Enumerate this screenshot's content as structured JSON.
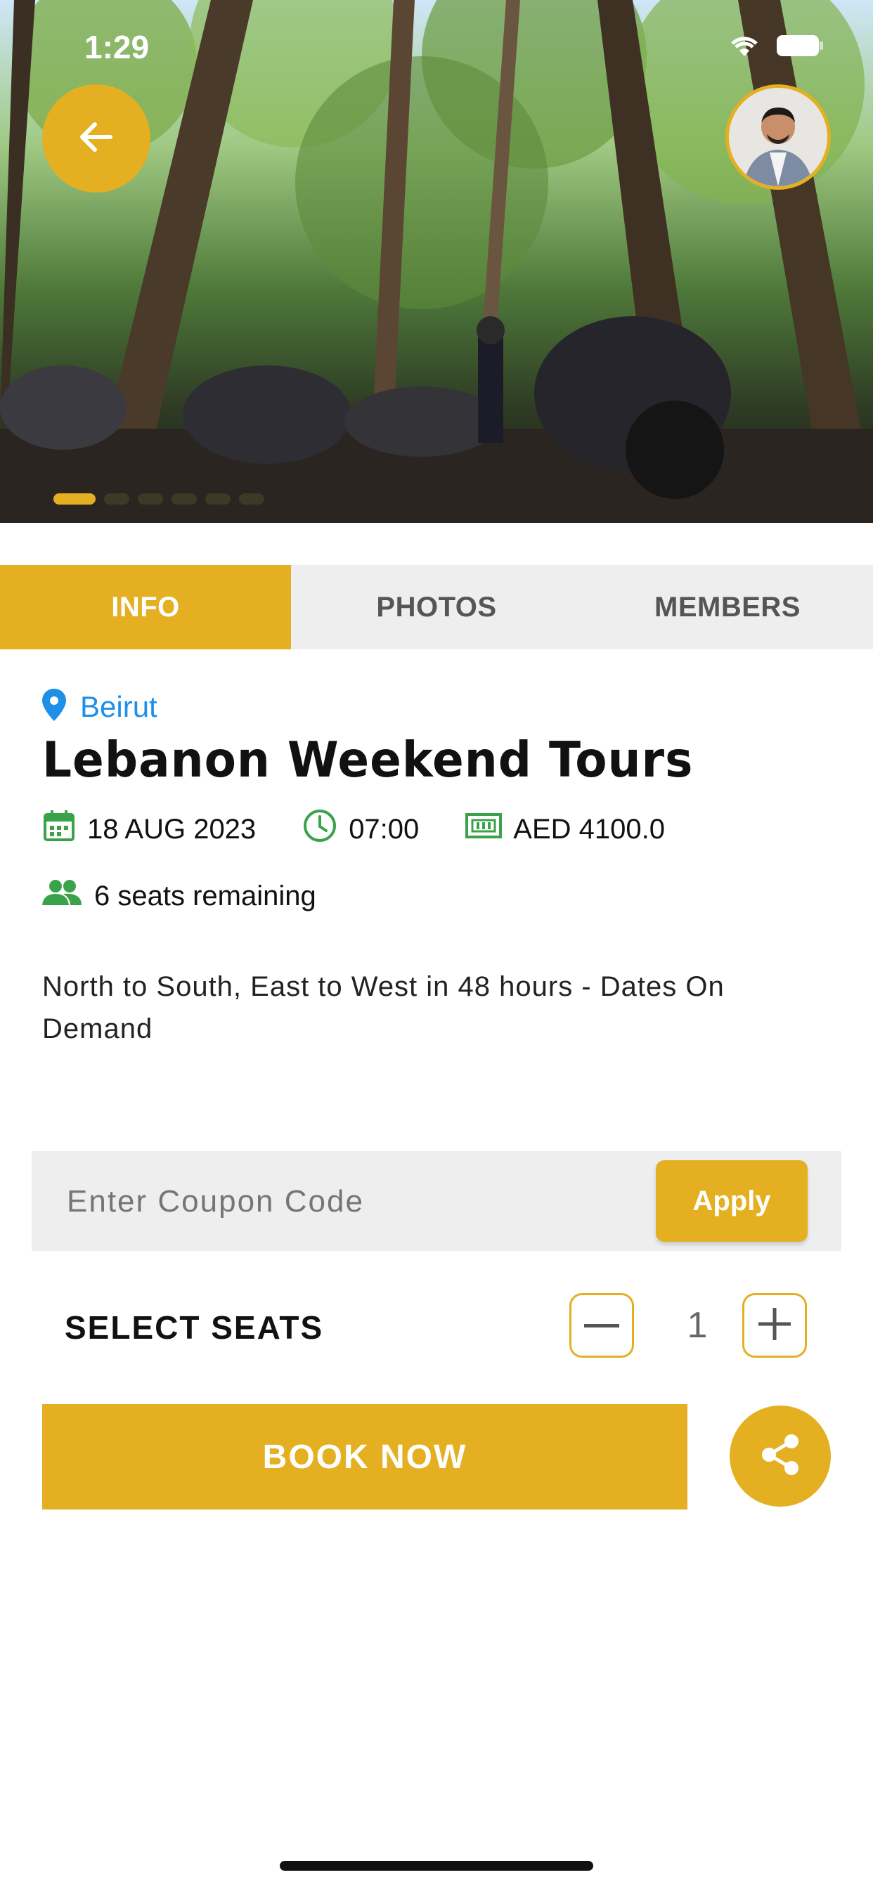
{
  "status_bar": {
    "time": "1:29"
  },
  "hero": {
    "image_alt": "Motorcycles parked in a forest",
    "carousel_dot_count": 6,
    "carousel_active_index": 0
  },
  "tabs": [
    {
      "label": "INFO",
      "active": true
    },
    {
      "label": "PHOTOS",
      "active": false
    },
    {
      "label": "MEMBERS",
      "active": false
    }
  ],
  "event": {
    "location": "Beirut",
    "title": "Lebanon Weekend Tours",
    "date": "18 AUG 2023",
    "time": "07:00",
    "price": "AED 4100.0",
    "seats_remaining": "6 seats remaining",
    "description": "North to South, East to West in 48 hours - Dates On Demand"
  },
  "coupon": {
    "placeholder": "Enter Coupon Code",
    "value": "",
    "apply_label": "Apply"
  },
  "seat_selector": {
    "label": "SELECT SEATS",
    "value": "1"
  },
  "actions": {
    "book_label": "BOOK NOW"
  },
  "icons": {
    "back": "arrow-left-icon",
    "location": "map-pin-icon",
    "date": "calendar-icon",
    "time": "clock-icon",
    "price": "money-icon",
    "seats": "people-icon",
    "decrease": "minus-icon",
    "increase": "plus-icon",
    "share": "share-icon",
    "wifi": "wifi-icon",
    "battery": "battery-icon"
  },
  "colors": {
    "accent": "#e4b022",
    "location_blue": "#1e90e8",
    "icon_green": "#3aa34a",
    "tab_bg": "#eeeeee"
  }
}
